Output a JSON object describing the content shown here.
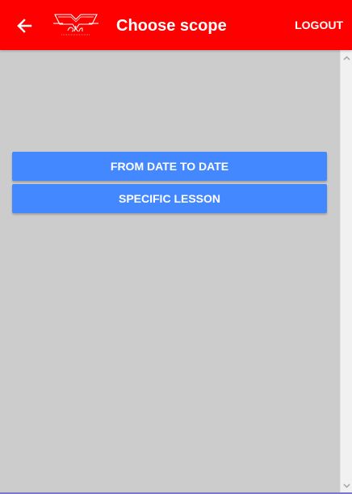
{
  "app_bar": {
    "title": "Choose scope",
    "logout_label": "LOGOUT",
    "back_icon": "arrow-left-icon",
    "logo_icon": "akn-logo",
    "background_color": "#ff0000"
  },
  "actions": {
    "from_date_label": "FROM DATE TO DATE",
    "specific_lesson_label": "SPECIFIC LESSON",
    "button_color": "#4488ff"
  },
  "page": {
    "background_color": "#cccccc"
  }
}
